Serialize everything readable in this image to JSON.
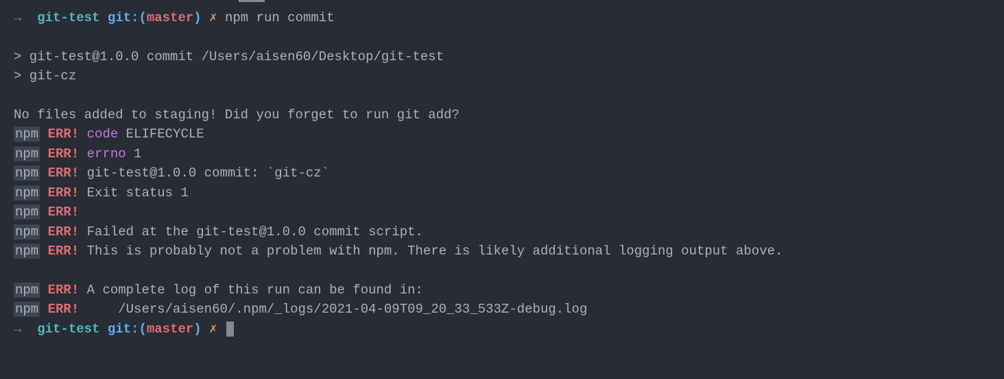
{
  "prompt1": {
    "arrow": "→",
    "dir": "git-test",
    "git_prefix": "git:(",
    "branch": "master",
    "git_suffix": ")",
    "dirty": "✗",
    "command": "npm run commit"
  },
  "output": {
    "line1": "> git-test@1.0.0 commit /Users/aisen60/Desktop/git-test",
    "line2": "> git-cz",
    "line3": "No files added to staging! Did you forget to run git add?",
    "npm_label": "npm",
    "err_label": "ERR!",
    "err1_key": "code",
    "err1_val": " ELIFECYCLE",
    "err2_key": "errno",
    "err2_val": " 1",
    "err3": " git-test@1.0.0 commit: `git-cz`",
    "err4": " Exit status 1",
    "err5": "",
    "err6": " Failed at the git-test@1.0.0 commit script.",
    "err7": " This is probably not a problem with npm. There is likely additional logging output above.",
    "err8": " A complete log of this run can be found in:",
    "err9": "     /Users/aisen60/.npm/_logs/2021-04-09T09_20_33_533Z-debug.log"
  },
  "prompt2": {
    "arrow": "→",
    "dir": "git-test",
    "git_prefix": "git:(",
    "branch": "master",
    "git_suffix": ")",
    "dirty": "✗"
  }
}
